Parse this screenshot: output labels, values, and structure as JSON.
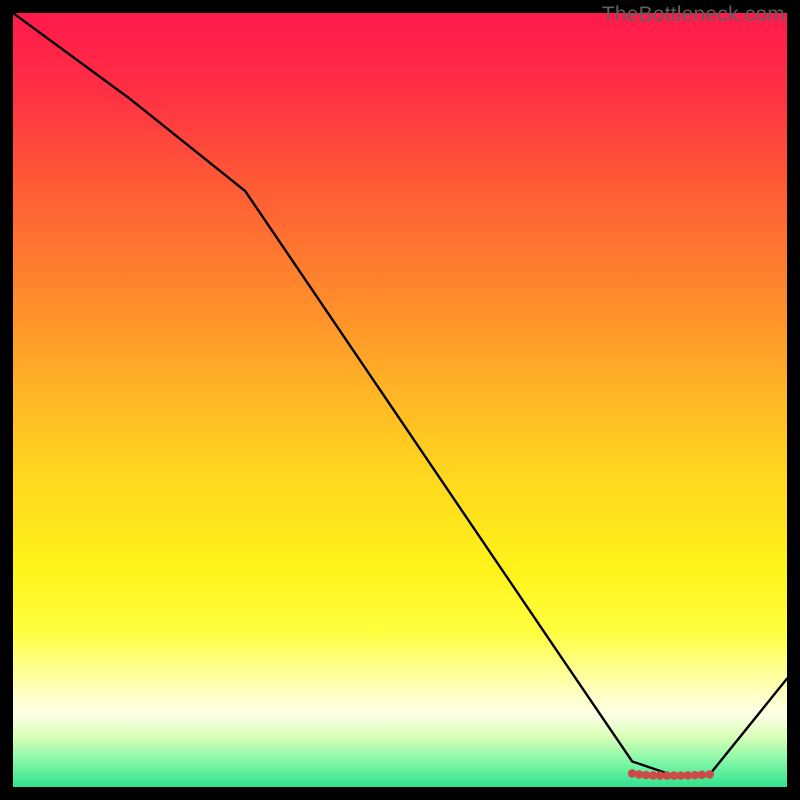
{
  "watermark": "TheBottleneck.com",
  "chart_data": {
    "type": "line",
    "title": "",
    "xlabel": "",
    "ylabel": "",
    "xlim": [
      0,
      100
    ],
    "ylim": [
      0,
      100
    ],
    "grid": false,
    "background_gradient": {
      "stops": [
        {
          "offset": 0.0,
          "color": "#ff1a4b"
        },
        {
          "offset": 0.1,
          "color": "#ff2f44"
        },
        {
          "offset": 0.22,
          "color": "#ff5a36"
        },
        {
          "offset": 0.35,
          "color": "#ff842c"
        },
        {
          "offset": 0.48,
          "color": "#ffb126"
        },
        {
          "offset": 0.6,
          "color": "#ffd81f"
        },
        {
          "offset": 0.72,
          "color": "#fff31a"
        },
        {
          "offset": 0.8,
          "color": "#ffff40"
        },
        {
          "offset": 0.86,
          "color": "#ffffa4"
        },
        {
          "offset": 0.905,
          "color": "#ffffe8"
        },
        {
          "offset": 0.935,
          "color": "#d8ffb8"
        },
        {
          "offset": 0.965,
          "color": "#88f8a8"
        },
        {
          "offset": 1.0,
          "color": "#2fe38f"
        }
      ]
    },
    "series": [
      {
        "name": "curve",
        "color": "#000000",
        "width": 2.4,
        "x": [
          0.0,
          15.0,
          30.0,
          50.0,
          70.0,
          80.0,
          85.0,
          90.0,
          100.0
        ],
        "y": [
          100.0,
          89.0,
          77.0,
          47.5,
          18.0,
          3.3,
          1.6,
          1.6,
          14.0
        ]
      }
    ],
    "markers": {
      "name": "bottom-dots",
      "color": "#cc4b49",
      "radius": 4.3,
      "x": [
        80.0,
        80.9,
        81.8,
        82.7,
        83.6,
        84.5,
        85.4,
        86.3,
        87.2,
        88.1,
        89.0,
        90.0
      ],
      "y": [
        1.75,
        1.62,
        1.55,
        1.5,
        1.48,
        1.48,
        1.48,
        1.48,
        1.5,
        1.53,
        1.57,
        1.62
      ]
    }
  }
}
